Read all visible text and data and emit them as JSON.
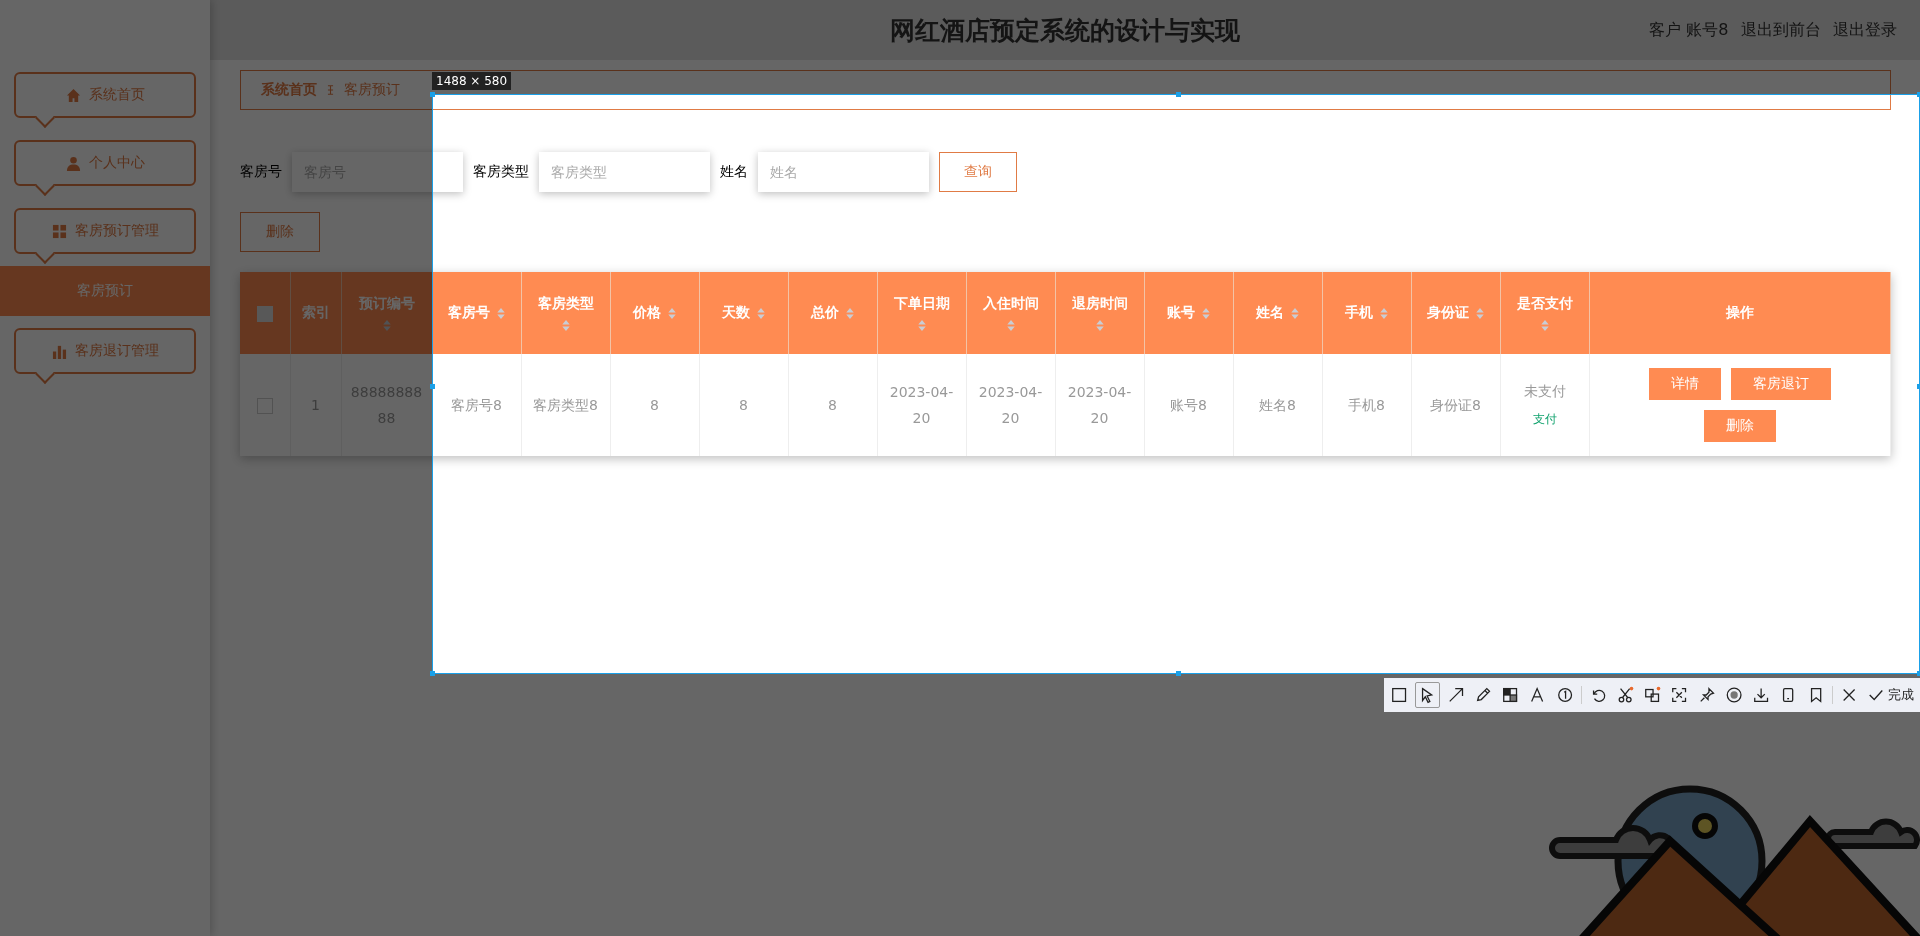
{
  "header": {
    "title": "网红酒店预定系统的设计与实现",
    "user": "客户 账号8",
    "links": [
      "退出到前台",
      "退出登录"
    ]
  },
  "sidebar": {
    "items": [
      {
        "label": "系统首页",
        "kind": "home"
      },
      {
        "label": "个人中心",
        "kind": "user"
      },
      {
        "label": "客房预订管理",
        "kind": "grid",
        "children": [
          {
            "label": "客房预订",
            "selected": true
          }
        ]
      },
      {
        "label": "客房退订管理",
        "kind": "chart"
      }
    ]
  },
  "breadcrumb": [
    "系统首页",
    "客房预订"
  ],
  "search": {
    "fields": [
      {
        "label": "客房号",
        "placeholder": "客房号"
      },
      {
        "label": "客房类型",
        "placeholder": "客房类型"
      },
      {
        "label": "姓名",
        "placeholder": "姓名"
      }
    ],
    "button": "查询"
  },
  "delete_button": "删除",
  "table": {
    "select_all_checked": false,
    "columns": [
      {
        "label": "索引",
        "sortable": false
      },
      {
        "label": "预订编号",
        "sortable": true
      },
      {
        "label": "客房号",
        "sortable": true
      },
      {
        "label": "客房类型",
        "sortable": true
      },
      {
        "label": "价格",
        "sortable": true
      },
      {
        "label": "天数",
        "sortable": true
      },
      {
        "label": "总价",
        "sortable": true
      },
      {
        "label": "下单日期",
        "sortable": true
      },
      {
        "label": "入住时间",
        "sortable": true
      },
      {
        "label": "退房时间",
        "sortable": true
      },
      {
        "label": "账号",
        "sortable": true
      },
      {
        "label": "姓名",
        "sortable": true
      },
      {
        "label": "手机",
        "sortable": true
      },
      {
        "label": "身份证",
        "sortable": true
      },
      {
        "label": "是否支付",
        "sortable": true
      },
      {
        "label": "操作",
        "sortable": false
      }
    ],
    "rows": [
      {
        "checked": false,
        "cells": [
          "1",
          "8888888888",
          "客房号8",
          "客房类型8",
          "8",
          "8",
          "8",
          "2023-04-20",
          "2023-04-20",
          "2023-04-20",
          "账号8",
          "姓名8",
          "手机8",
          "身份证8"
        ],
        "paid": "未支付",
        "pay_link": "支付",
        "actions": [
          "详情",
          "客房退订",
          "删除"
        ]
      }
    ]
  },
  "capture": {
    "size_label": "1488 × 580",
    "done_label": "完成"
  }
}
